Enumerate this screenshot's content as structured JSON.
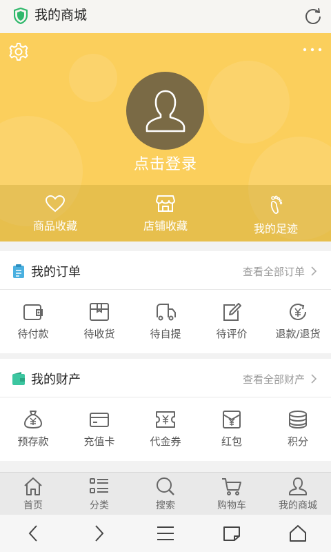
{
  "topbar": {
    "title": "我的商城",
    "left_icon": "shield-icon",
    "right_icon": "refresh-icon"
  },
  "hero": {
    "login_text": "点击登录",
    "color": "#fbcf5c",
    "items": [
      {
        "label": "商品收藏",
        "icon": "heart-icon"
      },
      {
        "label": "店铺收藏",
        "icon": "store-icon"
      },
      {
        "label": "我的足迹",
        "icon": "footprint-icon"
      }
    ]
  },
  "orders": {
    "title": "我的订单",
    "link": "查看全部订单",
    "items": [
      {
        "label": "待付款",
        "icon": "wallet-icon"
      },
      {
        "label": "待收货",
        "icon": "package-icon"
      },
      {
        "label": "待自提",
        "icon": "truck-icon"
      },
      {
        "label": "待评价",
        "icon": "edit-icon"
      },
      {
        "label": "退款/退货",
        "icon": "refund-icon"
      }
    ]
  },
  "assets": {
    "title": "我的财产",
    "link": "查看全部财产",
    "items": [
      {
        "label": "预存款",
        "icon": "money-bag-icon"
      },
      {
        "label": "充值卡",
        "icon": "card-icon"
      },
      {
        "label": "代金券",
        "icon": "voucher-icon"
      },
      {
        "label": "红包",
        "icon": "red-envelope-icon"
      },
      {
        "label": "积分",
        "icon": "coins-icon"
      }
    ]
  },
  "tabbar": {
    "items": [
      {
        "label": "首页",
        "icon": "home-icon"
      },
      {
        "label": "分类",
        "icon": "list-icon"
      },
      {
        "label": "搜索",
        "icon": "search-icon"
      },
      {
        "label": "购物车",
        "icon": "cart-icon"
      },
      {
        "label": "我的商城",
        "icon": "user-icon"
      }
    ]
  },
  "colors": {
    "accent_orders": "#4ab0e0",
    "accent_assets": "#3cc6a0",
    "icon_gray": "#666666"
  }
}
